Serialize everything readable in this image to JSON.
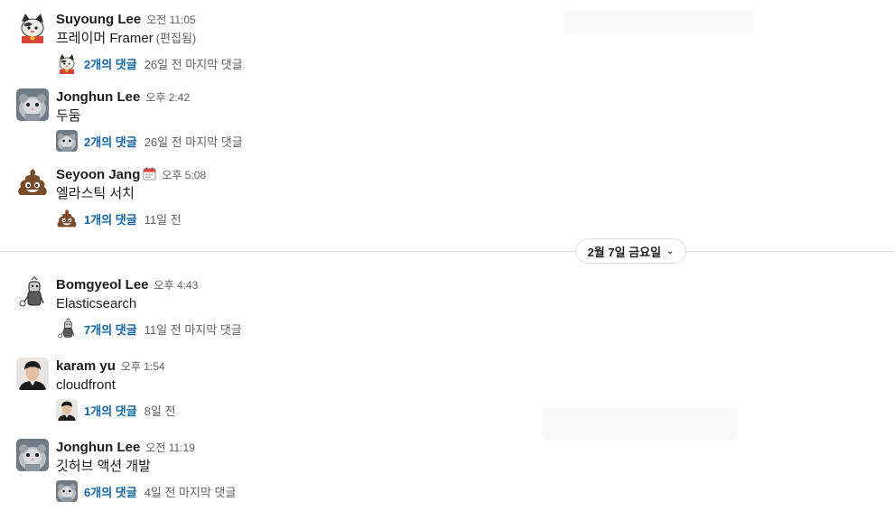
{
  "messages": [
    {
      "author": "Suyoung Lee",
      "time": "오전 11:05",
      "text": "프레이머 Framer",
      "edited": "(편집됨)",
      "replies": "2개의 댓글",
      "last_reply": "26일 전 마지막 댓글",
      "avatar": "cat-avatar"
    },
    {
      "author": "Jonghun Lee",
      "time": "오후 2:42",
      "text": "두둠",
      "replies": "2개의 댓글",
      "last_reply": "26일 전 마지막 댓글",
      "avatar": "hamster-avatar"
    },
    {
      "author": "Seyoon Jang",
      "status_icon": "calendar-icon",
      "time": "오후 5:08",
      "text": "엘라스틱 서치",
      "replies": "1개의 댓글",
      "last_reply": "11일 전",
      "avatar": "poop-avatar"
    },
    {
      "author": "Bomgyeol Lee",
      "time": "오후 4:43",
      "text": "Elasticsearch",
      "replies": "7개의 댓글",
      "last_reply": "11일 전 마지막 댓글",
      "avatar": "sketch-avatar"
    },
    {
      "author": "karam yu",
      "time": "오후 1:54",
      "text": "cloudfront",
      "replies": "1개의 댓글",
      "last_reply": "8일 전",
      "avatar": "photo-avatar"
    },
    {
      "author": "Jonghun Lee",
      "time": "오전 11:19",
      "text": "깃허브 액션 개발",
      "replies": "6개의 댓글",
      "last_reply": "4일 전 마지막 댓글",
      "avatar": "hamster-avatar"
    }
  ],
  "date_divider": {
    "label": "2월 7일 금요일",
    "chevron": "chevron-down-icon"
  },
  "colors": {
    "link": "#1264a3",
    "muted": "#616061",
    "text": "#1d1c1d",
    "divider": "#dddddd"
  }
}
